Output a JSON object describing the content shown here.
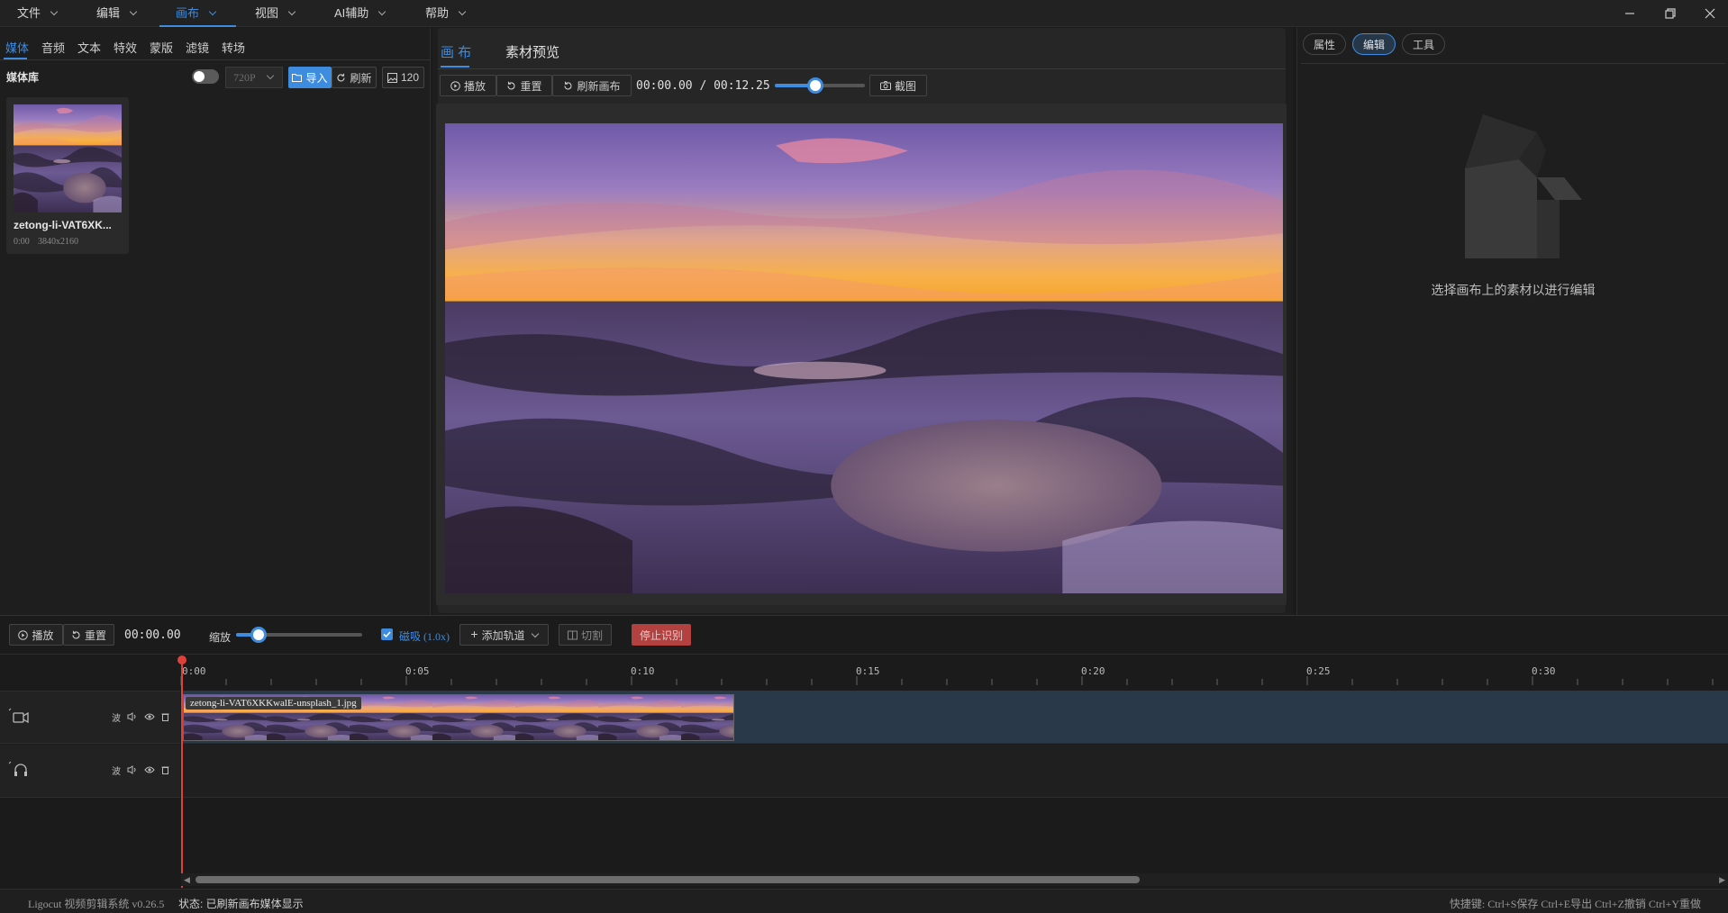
{
  "menu": {
    "items": [
      "文件",
      "编辑",
      "画布",
      "视图",
      "AI辅助",
      "帮助"
    ],
    "active_index": 2
  },
  "left": {
    "tabs": [
      "媒体",
      "音频",
      "文本",
      "特效",
      "蒙版",
      "滤镜",
      "转场"
    ],
    "library_title": "媒体库",
    "resolution": "720P",
    "import_label": "导入",
    "refresh_label": "刷新",
    "count": "120",
    "media": {
      "name": "zetong-li-VAT6XK...",
      "duration": "0:00",
      "size": "3840x2160"
    }
  },
  "preview": {
    "tabs": [
      "画 布",
      "素材预览"
    ],
    "play_label": "播放",
    "reset_label": "重置",
    "refresh_canvas_label": "刷新画布",
    "time": "00:00.00 / 00:12.25",
    "screenshot_label": "截图",
    "volume_level": 0.45
  },
  "right": {
    "tabs": [
      "属性",
      "编辑",
      "工具"
    ],
    "active_index": 1,
    "empty_text": "选择画布上的素材以进行编辑"
  },
  "timeline": {
    "play_label": "播放",
    "reset_label": "重置",
    "time": "00:00.00",
    "zoom_label": "缩放",
    "zoom_level": 0.18,
    "snap_label": "磁吸 (1.0x)",
    "add_track_label": "添加轨道",
    "cut_label": "切割",
    "stop_label": "停止识别",
    "ruler": [
      "0:00",
      "0:05",
      "0:10",
      "0:15",
      "0:20",
      "0:25",
      "0:30"
    ],
    "track_btn": "波",
    "clip_name": "zetong-li-VAT6XKKwalE-unsplash_1.jpg"
  },
  "status": {
    "app": "Ligocut 视频剪辑系统 v0.26.5",
    "state": "状态: 已刷新画布媒体显示",
    "shortcuts": "快捷键: Ctrl+S保存 Ctrl+E导出 Ctrl+Z撤销 Ctrl+Y重做"
  },
  "colors": {
    "accent": "#3d8ce0",
    "danger": "#b2413f",
    "playhead": "#e0403a"
  }
}
